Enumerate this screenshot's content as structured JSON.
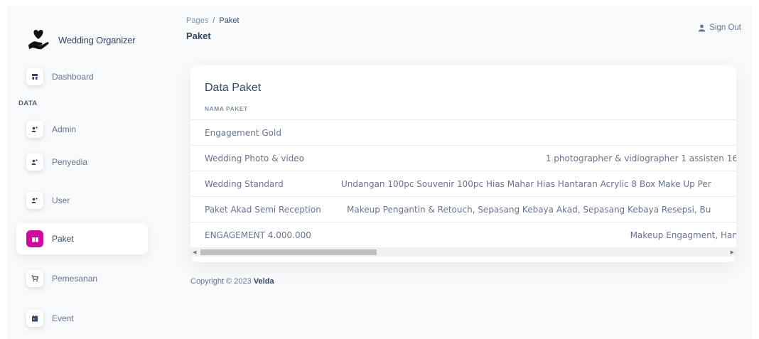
{
  "brand": {
    "name": "Wedding Organizer"
  },
  "sidebar": {
    "section_label": "DATA",
    "items": [
      {
        "label": "Dashboard",
        "icon": "shop-icon",
        "active": false
      },
      {
        "label": "Admin",
        "icon": "users-icon",
        "active": false
      },
      {
        "label": "Penyedia",
        "icon": "users-icon",
        "active": false
      },
      {
        "label": "User",
        "icon": "users-icon",
        "active": false
      },
      {
        "label": "Paket",
        "icon": "box-icon",
        "active": true
      },
      {
        "label": "Pemesanan",
        "icon": "cart-icon",
        "active": false
      },
      {
        "label": "Event",
        "icon": "calendar-icon",
        "active": false
      }
    ]
  },
  "header": {
    "breadcrumb_root": "Pages",
    "breadcrumb_sep": "/",
    "breadcrumb_current": "Paket",
    "title": "Paket",
    "signout_label": "Sign Out"
  },
  "card": {
    "title": "Data Paket",
    "column_header": "NAMA PAKET",
    "rows": [
      {
        "name": "Engagement Gold",
        "description": ""
      },
      {
        "name": "Wedding Photo & video",
        "description": "1 photographer & vidiographer 1 assisten 16"
      },
      {
        "name": "Wedding Standard",
        "description": "Undangan 100pc Souvenir 100pc Hias Mahar Hias Hantaran Acrylic 8 Box Make Up Per"
      },
      {
        "name": "Paket Akad Semi Reception",
        "description": "Makeup Pengantin & Retouch, Sepasang Kebaya Akad, Sepasang Kebaya Resepsi, Bu"
      },
      {
        "name": "ENGAGEMENT 4.000.000",
        "description": "Makeup Engagment, Han"
      }
    ],
    "scroll_position": 0.0
  },
  "footer": {
    "copyright": "Copyright © 2023",
    "author": "Velda"
  },
  "colors": {
    "accent": "#cb0c9f",
    "text_dark": "#344767",
    "text_muted": "#67748e",
    "background": "#f8f9fa"
  }
}
